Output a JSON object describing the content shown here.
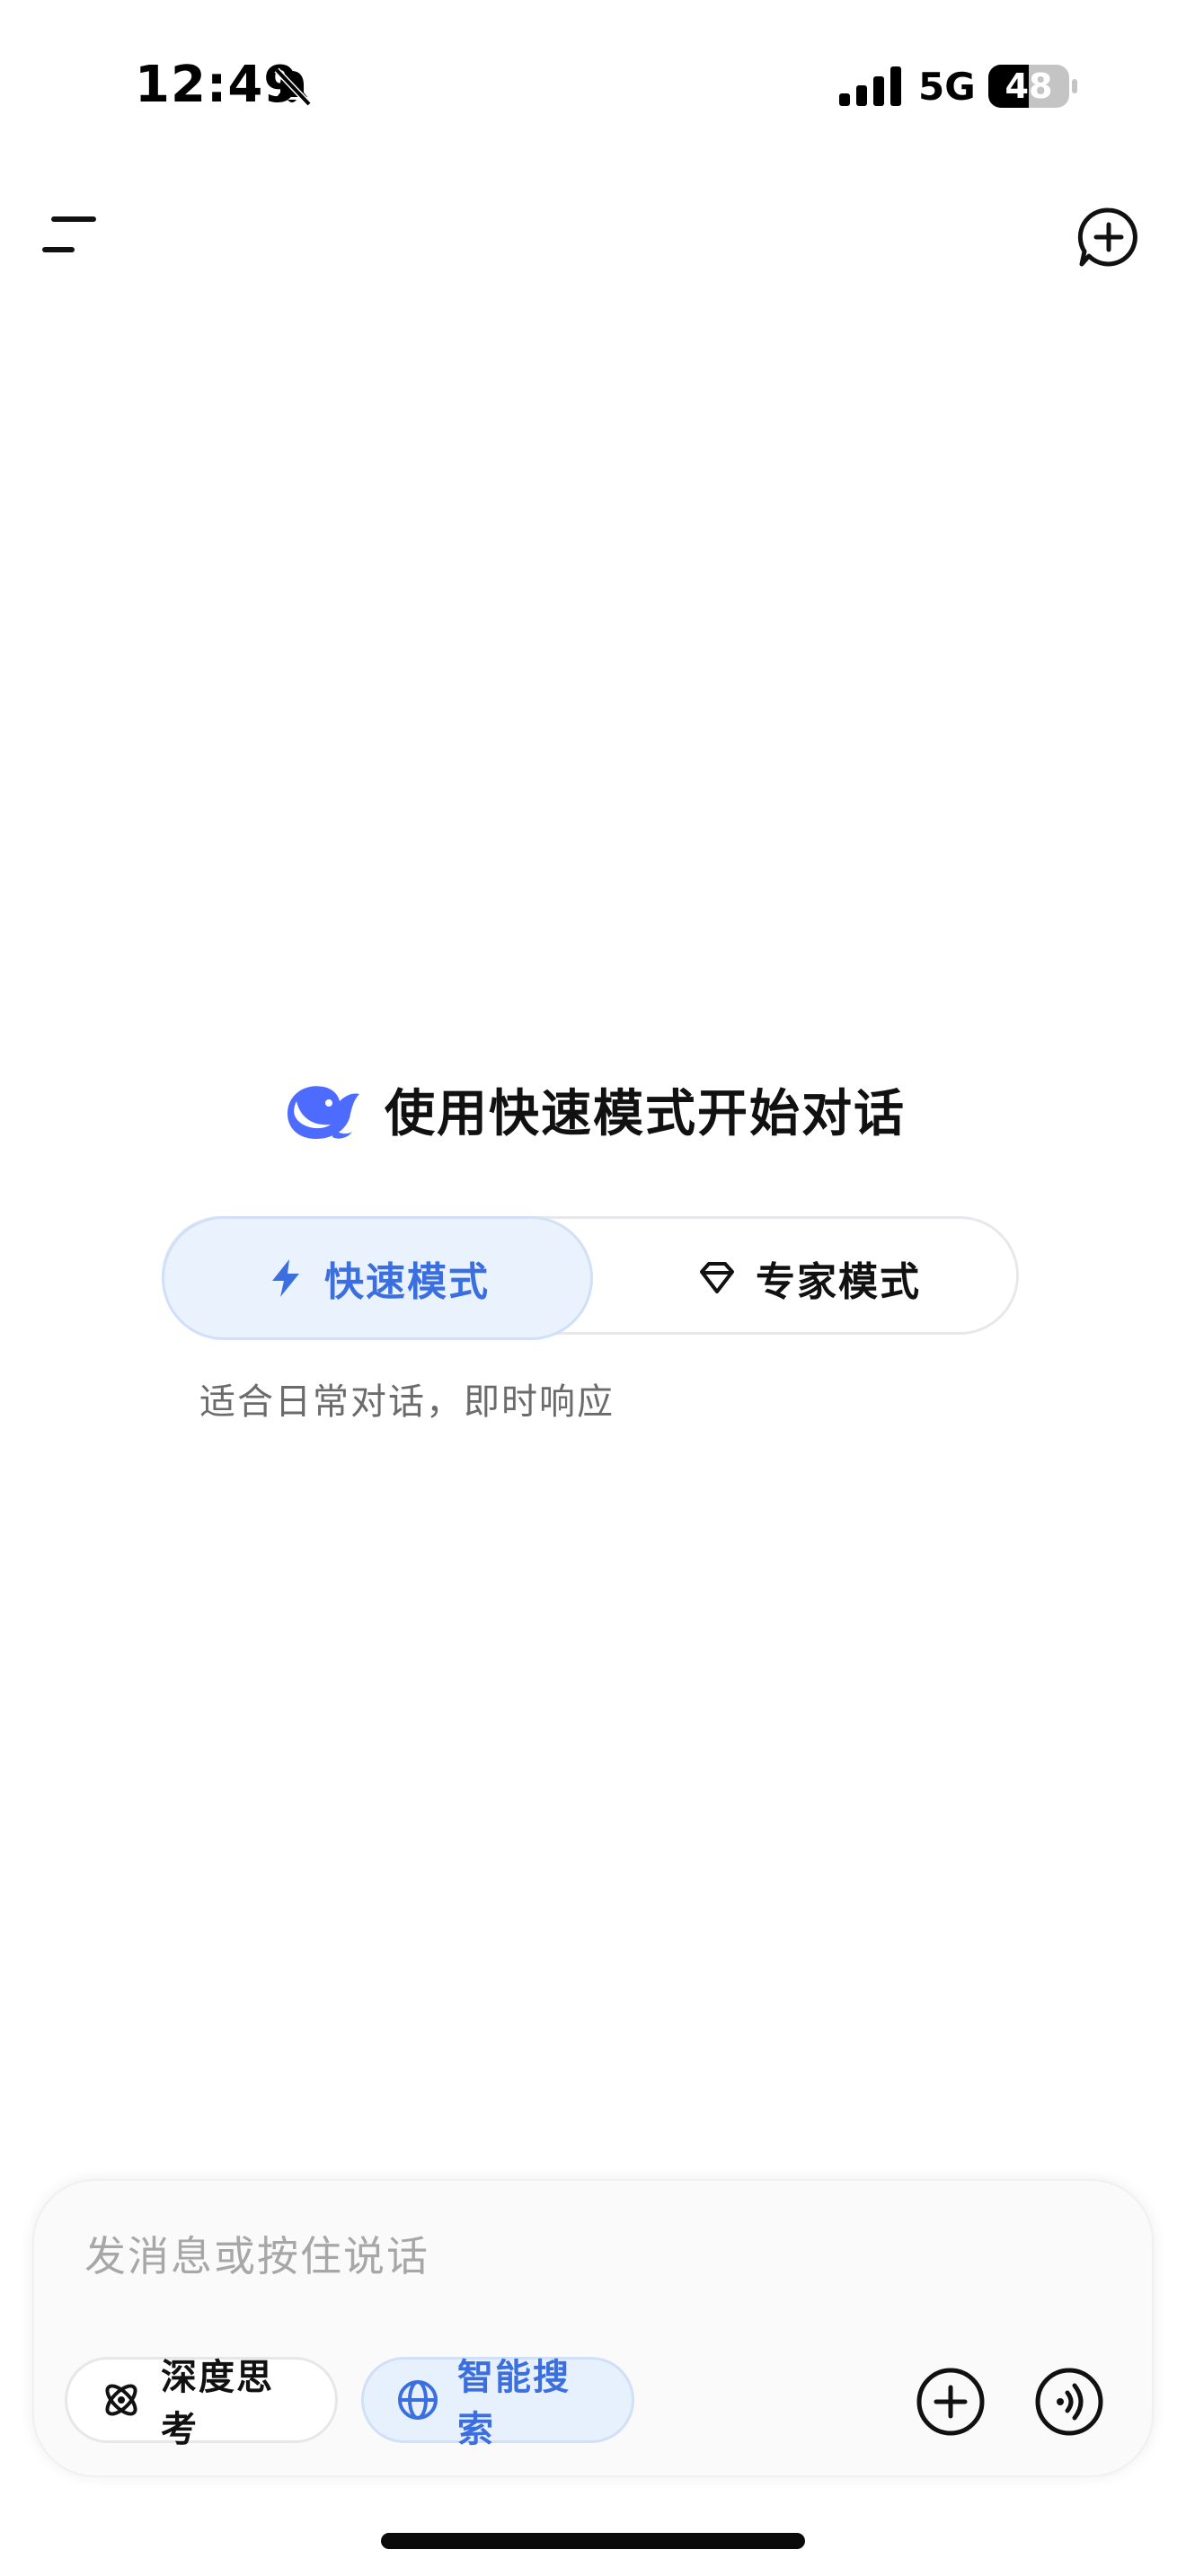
{
  "status_bar": {
    "time": "12:49",
    "network": "5G",
    "battery": "48"
  },
  "icons": {
    "menu": "menu-lines-icon",
    "new_chat": "new-chat-plus-icon",
    "logo": "whale-logo-icon",
    "fast": "lightning-icon",
    "expert": "diamond-icon",
    "deep_think": "atom-icon",
    "search": "globe-icon",
    "attach": "plus-circle-icon",
    "voice": "voice-wave-icon"
  },
  "hero": {
    "title": "使用快速模式开始对话"
  },
  "modes": {
    "fast_label": "快速模式",
    "expert_label": "专家模式",
    "selected": "快速模式",
    "description": "适合日常对话，即时响应"
  },
  "input": {
    "placeholder": "发消息或按住说话",
    "value": ""
  },
  "chips": {
    "deep_think_label": "深度思考",
    "search_label": "智能搜索",
    "search_active": true
  },
  "colors": {
    "accent": "#3b6fe0",
    "accent_bg": "#eaf2fd",
    "text_primary": "#111111",
    "text_secondary": "#6b6b6b",
    "placeholder": "#a7a7a7"
  }
}
